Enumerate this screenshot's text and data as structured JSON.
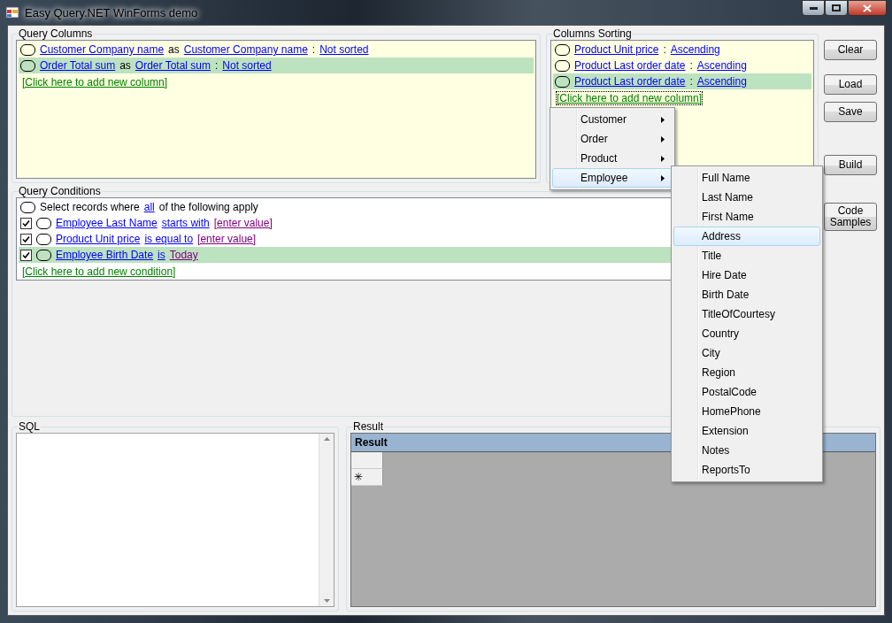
{
  "window": {
    "title": "Easy Query.NET WinForms demo"
  },
  "query_columns": {
    "title": "Query Columns",
    "rows": [
      {
        "selected": false,
        "parts": [
          {
            "text": "Customer Company name",
            "kind": "link"
          },
          {
            "text": "as",
            "kind": "plain"
          },
          {
            "text": "Customer Company name",
            "kind": "link"
          },
          {
            "text": ":",
            "kind": "plain"
          },
          {
            "text": "Not sorted",
            "kind": "link"
          }
        ]
      },
      {
        "selected": true,
        "parts": [
          {
            "text": "Order Total sum",
            "kind": "link"
          },
          {
            "text": "as",
            "kind": "plain"
          },
          {
            "text": "Order Total sum",
            "kind": "link"
          },
          {
            "text": ":",
            "kind": "plain"
          },
          {
            "text": "Not sorted",
            "kind": "link"
          }
        ]
      }
    ],
    "add_link": "[Click here to add new column]"
  },
  "columns_sorting": {
    "title": "Columns Sorting",
    "rows": [
      {
        "selected": false,
        "parts": [
          {
            "text": "Product Unit price",
            "kind": "link"
          },
          {
            "text": ":",
            "kind": "plain"
          },
          {
            "text": "Ascending",
            "kind": "link"
          }
        ]
      },
      {
        "selected": false,
        "parts": [
          {
            "text": "Product Last order date",
            "kind": "link"
          },
          {
            "text": ":",
            "kind": "plain"
          },
          {
            "text": "Ascending",
            "kind": "link"
          }
        ]
      },
      {
        "selected": true,
        "parts": [
          {
            "text": "Product Last order date",
            "kind": "link"
          },
          {
            "text": ":",
            "kind": "plain"
          },
          {
            "text": "Ascending",
            "kind": "link"
          }
        ]
      }
    ],
    "add_link": "[Click here to add new column]"
  },
  "buttons": [
    "Clear",
    "Load",
    "Save",
    "Build",
    "Code Samples"
  ],
  "query_conditions": {
    "title": "Query Conditions",
    "rows": [
      {
        "kind": "header",
        "selected": false,
        "parts": [
          {
            "text": "Select records where",
            "kind": "plain"
          },
          {
            "text": "all",
            "kind": "link"
          },
          {
            "text": "of the following apply",
            "kind": "plain"
          }
        ]
      },
      {
        "kind": "condition",
        "checked": true,
        "selected": false,
        "parts": [
          {
            "text": "Employee Last Name",
            "kind": "link"
          },
          {
            "text": "starts with",
            "kind": "link"
          },
          {
            "text": "[enter value]",
            "kind": "value"
          }
        ]
      },
      {
        "kind": "condition",
        "checked": true,
        "selected": false,
        "parts": [
          {
            "text": "Product Unit price",
            "kind": "link"
          },
          {
            "text": "is equal to",
            "kind": "link"
          },
          {
            "text": "[enter value]",
            "kind": "value"
          }
        ]
      },
      {
        "kind": "condition",
        "checked": true,
        "selected": true,
        "parts": [
          {
            "text": "Employee Birth Date",
            "kind": "link"
          },
          {
            "text": "is",
            "kind": "link"
          },
          {
            "text": "Today",
            "kind": "value"
          }
        ]
      }
    ],
    "add_link": "[Click here to add new condition]"
  },
  "sql": {
    "title": "SQL"
  },
  "result": {
    "title": "Result",
    "grid_header": "Result",
    "new_row_marker": "✳"
  },
  "context_menu": {
    "items": [
      {
        "label": "Customer",
        "selected": false
      },
      {
        "label": "Order",
        "selected": false
      },
      {
        "label": "Product",
        "selected": false
      },
      {
        "label": "Employee",
        "selected": true
      }
    ]
  },
  "submenu": {
    "items": [
      {
        "label": "Full Name",
        "selected": false
      },
      {
        "label": "Last Name",
        "selected": false
      },
      {
        "label": "First Name",
        "selected": false
      },
      {
        "label": "Address",
        "selected": true
      },
      {
        "label": "Title",
        "selected": false
      },
      {
        "label": "Hire Date",
        "selected": false
      },
      {
        "label": "Birth Date",
        "selected": false
      },
      {
        "label": "TitleOfCourtesy",
        "selected": false
      },
      {
        "label": "Country",
        "selected": false
      },
      {
        "label": "City",
        "selected": false
      },
      {
        "label": "Region",
        "selected": false
      },
      {
        "label": "PostalCode",
        "selected": false
      },
      {
        "label": "HomePhone",
        "selected": false
      },
      {
        "label": "Extension",
        "selected": false
      },
      {
        "label": "Notes",
        "selected": false
      },
      {
        "label": "ReportsTo",
        "selected": false
      }
    ]
  }
}
